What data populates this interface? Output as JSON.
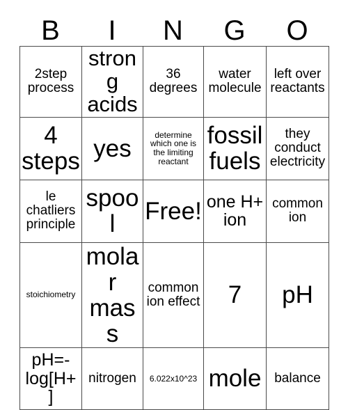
{
  "card": {
    "title_letters": [
      "B",
      "I",
      "N",
      "G",
      "O"
    ],
    "rows": [
      [
        {
          "text": "2step process",
          "size": "md"
        },
        {
          "text": "strong acids",
          "size": "xl"
        },
        {
          "text": "36 degrees",
          "size": "md"
        },
        {
          "text": "water molecule",
          "size": "md"
        },
        {
          "text": "left over reactants",
          "size": "md"
        }
      ],
      [
        {
          "text": "4 steps",
          "size": "xxl"
        },
        {
          "text": "yes",
          "size": "xxl"
        },
        {
          "text": "determine which one is the limiting reactant",
          "size": "xs"
        },
        {
          "text": "fossil fuels",
          "size": "xxl"
        },
        {
          "text": "they conduct electricity",
          "size": "md"
        }
      ],
      [
        {
          "text": "le chatliers principle",
          "size": "md"
        },
        {
          "text": "spool",
          "size": "xxl"
        },
        {
          "text": "Free!",
          "size": "xxl"
        },
        {
          "text": "one H+ ion",
          "size": "lg"
        },
        {
          "text": "common ion",
          "size": "md"
        }
      ],
      [
        {
          "text": "stoichiometry",
          "size": "xs"
        },
        {
          "text": "molar mass",
          "size": "xxl"
        },
        {
          "text": "common ion effect",
          "size": "md"
        },
        {
          "text": "7",
          "size": "xxl"
        },
        {
          "text": "pH",
          "size": "xxl"
        }
      ],
      [
        {
          "text": "pH=-log[H+ ]",
          "size": "lg"
        },
        {
          "text": "nitrogen",
          "size": "md"
        },
        {
          "text": "6.022x10^23",
          "size": "xs"
        },
        {
          "text": "mole",
          "size": "xxl"
        },
        {
          "text": "balance",
          "size": "md"
        }
      ]
    ]
  },
  "style": {
    "border_color": "#4a4a4a",
    "text_color": "#000000",
    "background": "#ffffff"
  }
}
